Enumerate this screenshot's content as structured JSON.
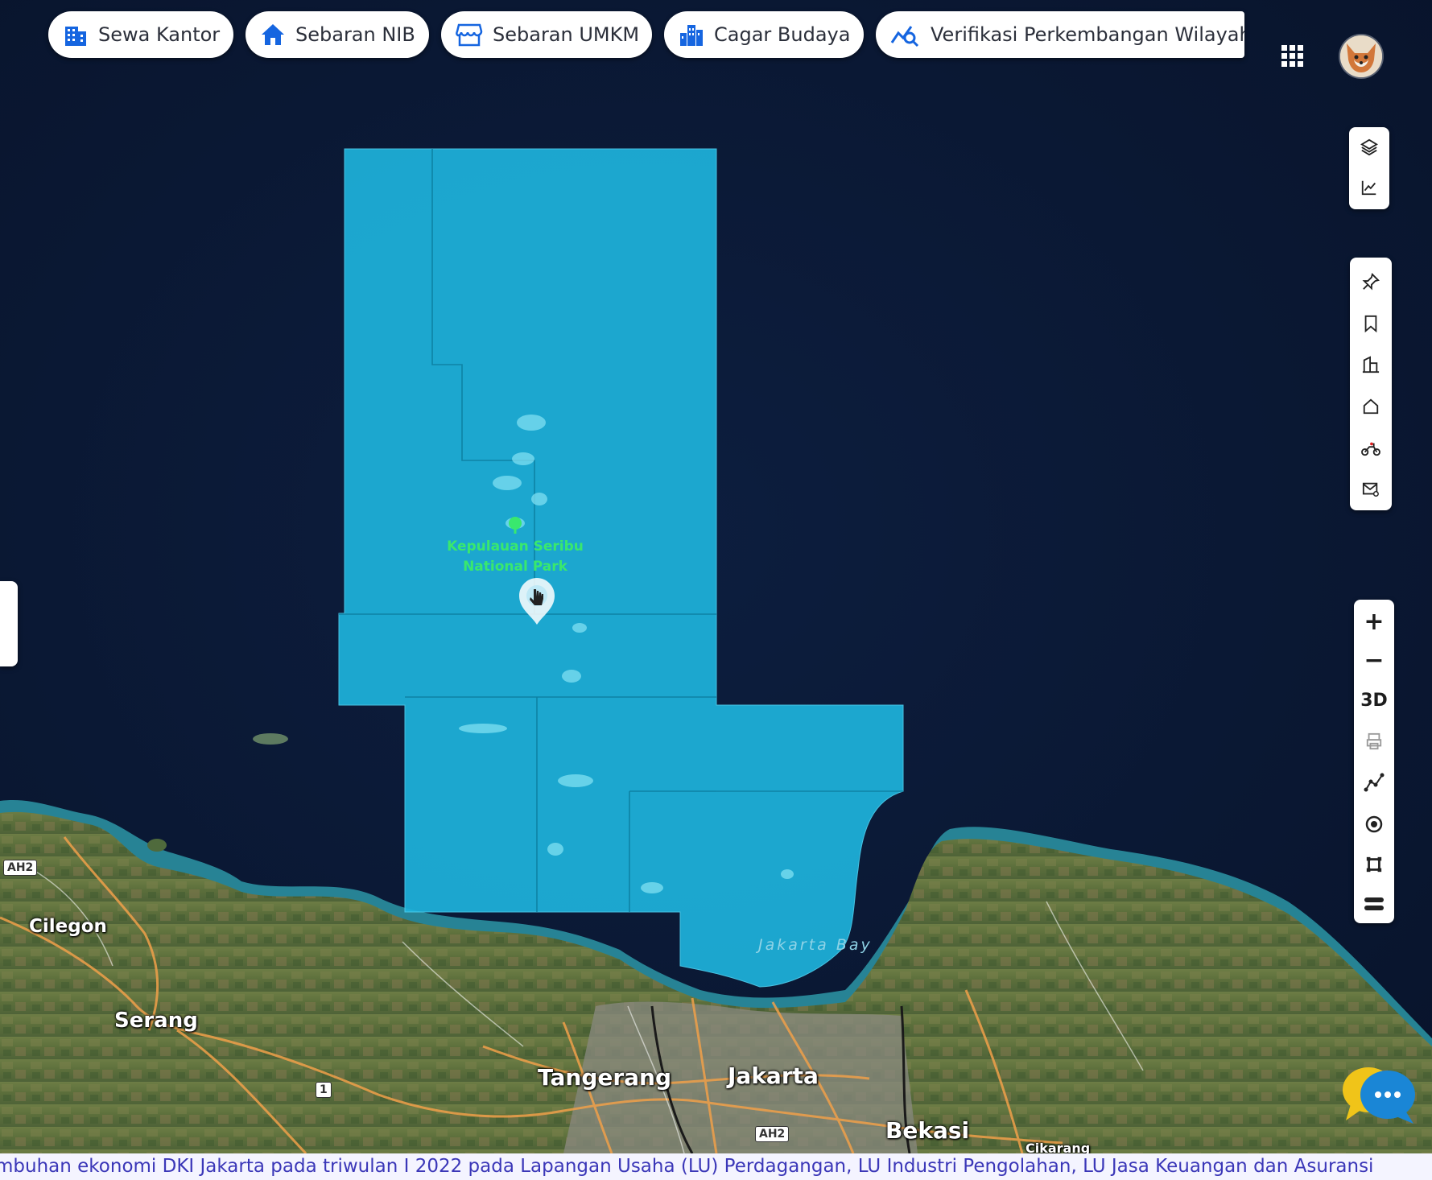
{
  "top_nav": {
    "chips": [
      {
        "label": "Sewa Kantor",
        "icon": "office-building-icon"
      },
      {
        "label": "Sebaran NIB",
        "icon": "home-icon"
      },
      {
        "label": "Sebaran UMKM",
        "icon": "storefront-icon"
      },
      {
        "label": "Cagar Budaya",
        "icon": "city-buildings-icon"
      },
      {
        "label": "Verifikasi Perkembangan Wilayah",
        "icon": "chart-search-icon"
      }
    ],
    "apps_icon": "grid-apps-icon",
    "avatar_icon": "avatar"
  },
  "toolbar_top": [
    "layers-icon",
    "line-chart-icon"
  ],
  "toolbar_middle": [
    "pin-icon",
    "bookmark-icon",
    "buildings-icon",
    "home-outline-icon",
    "motorbike-icon",
    "mail-settings-icon"
  ],
  "toolbar_bottom": {
    "zoom_in": "+",
    "zoom_out": "−",
    "mode_3d": "3D",
    "icons": [
      "print-icon",
      "route-icon",
      "locate-icon",
      "crop-icon",
      "stack-icon"
    ]
  },
  "map": {
    "park_label": {
      "line1": "Kepulauan Seribu",
      "line2": "National Park"
    },
    "bay_label": "Jakarta Bay",
    "cities": [
      "Cilegon",
      "Serang",
      "Tangerang",
      "Jakarta",
      "Bekasi",
      "Cikarang"
    ],
    "shields": [
      "AH2",
      "1",
      "AH2"
    ],
    "colors": {
      "sea": "#0b1731",
      "region_fill": "#1eb3dc",
      "land": "#5f7440"
    }
  },
  "ticker_text": "mbuhan ekonomi DKI Jakarta pada triwulan I 2022 pada Lapangan Usaha (LU) Perdagangan, LU Industri Pengolahan, LU Jasa Keuangan dan Asuransi"
}
